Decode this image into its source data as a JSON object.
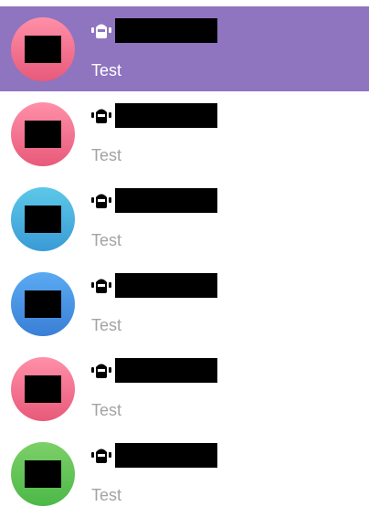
{
  "colors": {
    "selected_background": "#8f74c0",
    "preview_text": "#a3a3a3",
    "selected_text": "#ffffff",
    "icon_dark": "#000000",
    "icon_light": "#ffffff"
  },
  "chats": [
    {
      "preview": "Test",
      "selected": true,
      "avatar_top": "#ff8fa8",
      "avatar_bottom": "#e85a7a",
      "icon": "bot-icon"
    },
    {
      "preview": "Test",
      "selected": false,
      "avatar_top": "#ff8fa8",
      "avatar_bottom": "#e85a7a",
      "icon": "bot-icon"
    },
    {
      "preview": "Test",
      "selected": false,
      "avatar_top": "#5cc8e8",
      "avatar_bottom": "#3a9bd6",
      "icon": "bot-icon"
    },
    {
      "preview": "Test",
      "selected": false,
      "avatar_top": "#5aaaf2",
      "avatar_bottom": "#3a7fd6",
      "icon": "bot-icon"
    },
    {
      "preview": "Test",
      "selected": false,
      "avatar_top": "#ff8fa8",
      "avatar_bottom": "#e85a7a",
      "icon": "bot-icon"
    },
    {
      "preview": "Test",
      "selected": false,
      "avatar_top": "#7cd068",
      "avatar_bottom": "#4cb848",
      "icon": "bot-icon"
    }
  ]
}
